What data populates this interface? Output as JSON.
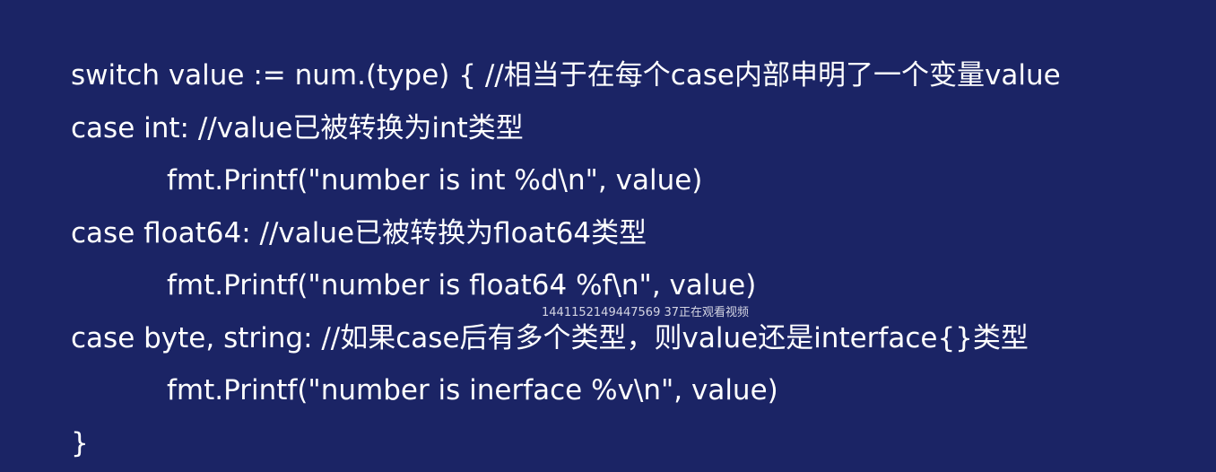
{
  "code_lines": [
    "switch value := num.(type) { //相当于在每个case内部申明了一个变量value",
    "case int: //value已被转换为int类型",
    "fmt.Printf(\"number is int %d\\n\", value)",
    "case float64: //value已被转换为float64类型",
    "fmt.Printf(\"number is float64 %f\\n\", value)",
    "case byte, string: //如果case后有多个类型，则value还是interface{}类型",
    "fmt.Printf(\"number is inerface %v\\n\", value)",
    "}"
  ],
  "watermark": "1441152149447569 37正在观看视频",
  "colors": {
    "background": "#1b2465",
    "text": "#ffffff"
  }
}
